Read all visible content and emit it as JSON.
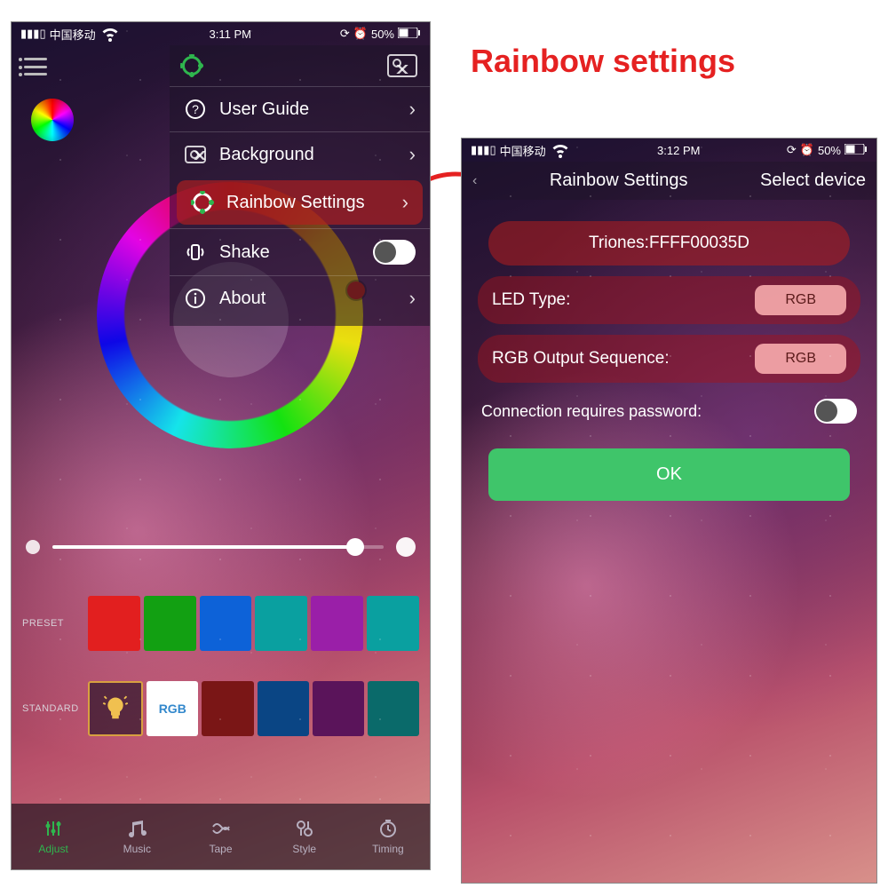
{
  "caption": "Rainbow settings",
  "left": {
    "status": {
      "carrier": "中国移动",
      "time": "3:11 PM",
      "battery": "50%"
    },
    "dropdown": {
      "items": [
        {
          "icon": "question",
          "label": "User Guide"
        },
        {
          "icon": "photo",
          "label": "Background"
        },
        {
          "icon": "gear",
          "label": "Rainbow Settings",
          "selected": true
        },
        {
          "icon": "shake",
          "label": "Shake",
          "toggle": false
        },
        {
          "icon": "info",
          "label": "About"
        }
      ]
    },
    "preset_label": "PRESET",
    "standard_label": "STANDARD",
    "standard_rgb_label": "RGB",
    "preset_colors": [
      "#e21f1f",
      "#12a012",
      "#0d62d8",
      "#0aa0a0",
      "#9a1fa8",
      "#0aa0a0"
    ],
    "standard_colors": [
      "bulb",
      "rgb",
      "#7a1616",
      "#0a4584",
      "#5a145a",
      "#0a6a6a"
    ],
    "tabs": [
      {
        "label": "Adjust",
        "active": true
      },
      {
        "label": "Music"
      },
      {
        "label": "Tape"
      },
      {
        "label": "Style"
      },
      {
        "label": "Timing"
      }
    ]
  },
  "right": {
    "status": {
      "carrier": "中国移动",
      "time": "3:12 PM",
      "battery": "50%"
    },
    "header": {
      "title": "Rainbow Settings",
      "select": "Select device"
    },
    "device": "Triones:FFFF00035D",
    "led_type": {
      "label": "LED Type:",
      "value": "RGB"
    },
    "rgb_seq": {
      "label": "RGB Output Sequence:",
      "value": "RGB"
    },
    "conn_pw": {
      "label": "Connection requires password:",
      "value": false
    },
    "ok": "OK"
  }
}
